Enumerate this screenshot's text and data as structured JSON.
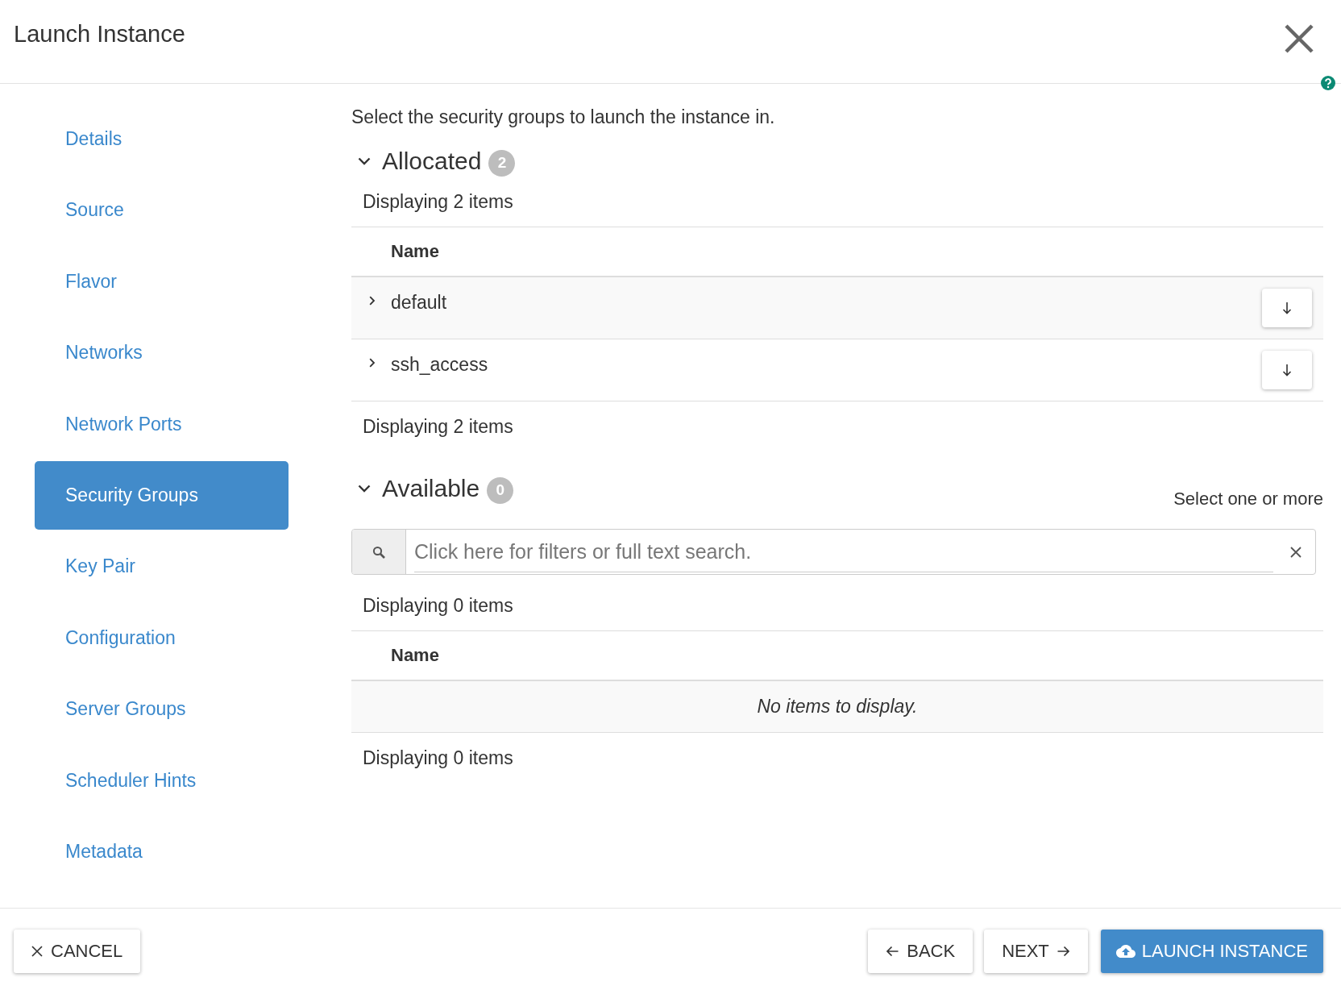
{
  "dialog": {
    "title": "Launch Instance"
  },
  "steps": [
    {
      "label": "Details",
      "selected": false
    },
    {
      "label": "Source",
      "selected": false
    },
    {
      "label": "Flavor",
      "selected": false
    },
    {
      "label": "Networks",
      "selected": false
    },
    {
      "label": "Network Ports",
      "selected": false
    },
    {
      "label": "Security Groups",
      "selected": true
    },
    {
      "label": "Key Pair",
      "selected": false
    },
    {
      "label": "Configuration",
      "selected": false
    },
    {
      "label": "Server Groups",
      "selected": false
    },
    {
      "label": "Scheduler Hints",
      "selected": false
    },
    {
      "label": "Metadata",
      "selected": false
    }
  ],
  "intro": "Select the security groups to launch the instance in.",
  "allocated": {
    "title": "Allocated",
    "count": "2",
    "expanded": true,
    "summary_top": "Displaying 2 items",
    "columns": [
      "Name"
    ],
    "rows": [
      {
        "name": "default",
        "expanded": false
      },
      {
        "name": "ssh_access",
        "expanded": false
      }
    ],
    "summary_bottom": "Displaying 2 items"
  },
  "available": {
    "title": "Available",
    "count": "0",
    "expanded": true,
    "hint": "Select one or more",
    "search": {
      "placeholder": "Click here for filters or full text search."
    },
    "summary_top": "Displaying 0 items",
    "columns": [
      "Name"
    ],
    "empty_message": "No items to display.",
    "summary_bottom": "Displaying 0 items"
  },
  "footer": {
    "buttons": [
      {
        "kind": "cancel",
        "label": "CANCEL"
      },
      {
        "kind": "back",
        "label": "BACK"
      },
      {
        "kind": "next",
        "label": "NEXT"
      },
      {
        "kind": "launch",
        "label": "LAUNCH INSTANCE"
      }
    ]
  }
}
